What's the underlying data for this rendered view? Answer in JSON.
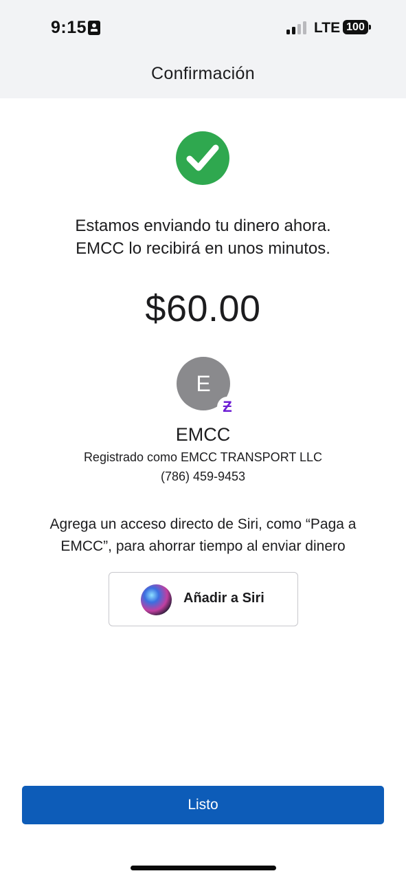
{
  "status_bar": {
    "time": "9:15",
    "network": "LTE",
    "battery": "100",
    "signal_bars_active": 2,
    "signal_bars_total": 4
  },
  "header": {
    "title": "Confirmación"
  },
  "confirmation": {
    "message_line1": "Estamos enviando tu dinero ahora.",
    "message_line2": "EMCC lo recibirá en unos minutos.",
    "amount": "$60.00"
  },
  "recipient": {
    "avatar_initial": "E",
    "badge_glyph": "Ƶ",
    "name": "EMCC",
    "registered_as": "Registrado como EMCC TRANSPORT LLC",
    "phone": "(786) 459-9453"
  },
  "siri": {
    "prompt_line1": "Agrega un acceso directo de Siri, como “Paga a",
    "prompt_line2": "EMCC”, para ahorrar tiempo al enviar dinero",
    "button_label": "Añadir a Siri"
  },
  "footer": {
    "done_label": "Listo"
  },
  "colors": {
    "success_green": "#2fa84f",
    "primary_blue": "#0d5cb8",
    "zelle_purple": "#6d1ed4",
    "avatar_gray": "#8a8a8d",
    "header_bg": "#f2f3f5"
  },
  "icons": [
    "id-card-icon",
    "signal-icon",
    "battery-icon",
    "checkmark-icon",
    "zelle-icon",
    "siri-icon"
  ]
}
